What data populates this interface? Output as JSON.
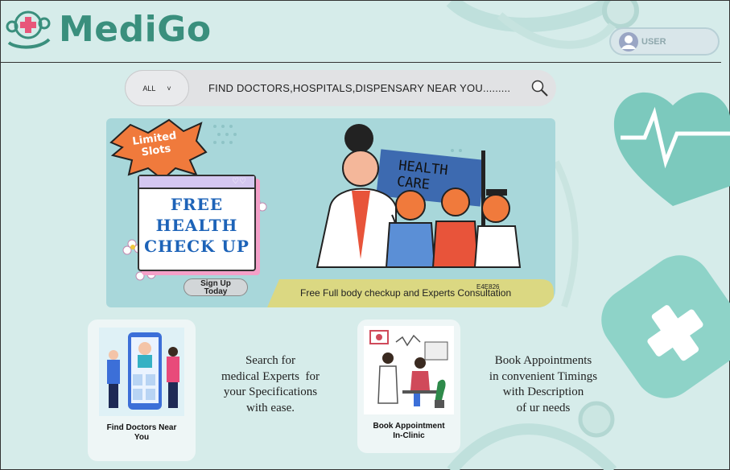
{
  "header": {
    "logo_text": "MediGo",
    "user_label": "USER"
  },
  "search": {
    "category": "ALL",
    "placeholder": "FIND DOCTORS,HOSPITALS,DISPENSARY NEAR YOU........."
  },
  "banner": {
    "burst": "Limited\nSlots",
    "title": "FREE\nHEALTH\nCHECK UP",
    "signup": "Sign Up\nToday",
    "flag": "HEALTH\nCARE",
    "caption": "Free Full body checkup and Experts Consultation",
    "code": "E4E826"
  },
  "features": [
    {
      "label": "Find Doctors Near\nYou",
      "description": "Search for\nmedical Experts  for\nyour Specifications\nwith ease."
    },
    {
      "label": "Book Appointment\nIn-Clinic",
      "description": "Book Appointments\nin convenient Timings\nwith Description\nof ur needs"
    }
  ],
  "colors": {
    "brand": "#3a8f7d",
    "background": "#d6ecea",
    "banner": "#a8d7da",
    "accent_orange": "#f07a3c",
    "title_blue": "#1d63b8",
    "caption_bar": "#e4d872"
  }
}
